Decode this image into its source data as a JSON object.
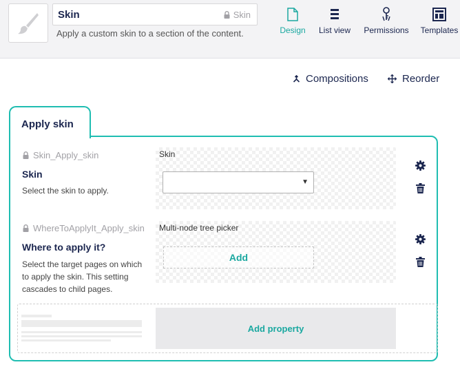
{
  "doctype": {
    "name": "Skin",
    "alias": "Skin",
    "description": "Apply a custom skin to a section of the content.",
    "icon": "paintbrush-icon"
  },
  "nav": [
    {
      "label": "Design",
      "icon": "document-icon",
      "active": true
    },
    {
      "label": "List view",
      "icon": "list-view-icon",
      "active": false
    },
    {
      "label": "Permissions",
      "icon": "keys-icon",
      "active": false
    },
    {
      "label": "Templates",
      "icon": "template-icon",
      "active": false
    }
  ],
  "actions": {
    "compositions": "Compositions",
    "reorder": "Reorder"
  },
  "group": {
    "name": "Apply skin",
    "properties": [
      {
        "alias": "Skin_Apply_skin",
        "label": "Skin",
        "description": "Select the skin to apply.",
        "editor": "Skin",
        "select_value": ""
      },
      {
        "alias": "WhereToApplyIt_Apply_skin",
        "label": "Where to apply it?",
        "description": "Select the target pages on which to apply the skin. This setting cascades to child pages.",
        "editor": "Multi-node tree picker",
        "add_label": "Add"
      }
    ],
    "add_property": "Add property"
  },
  "colors": {
    "accent": "#1ebdb1",
    "accent_text": "#1aa8a0",
    "text": "#1b264f",
    "muted": "#a2a1a6"
  }
}
